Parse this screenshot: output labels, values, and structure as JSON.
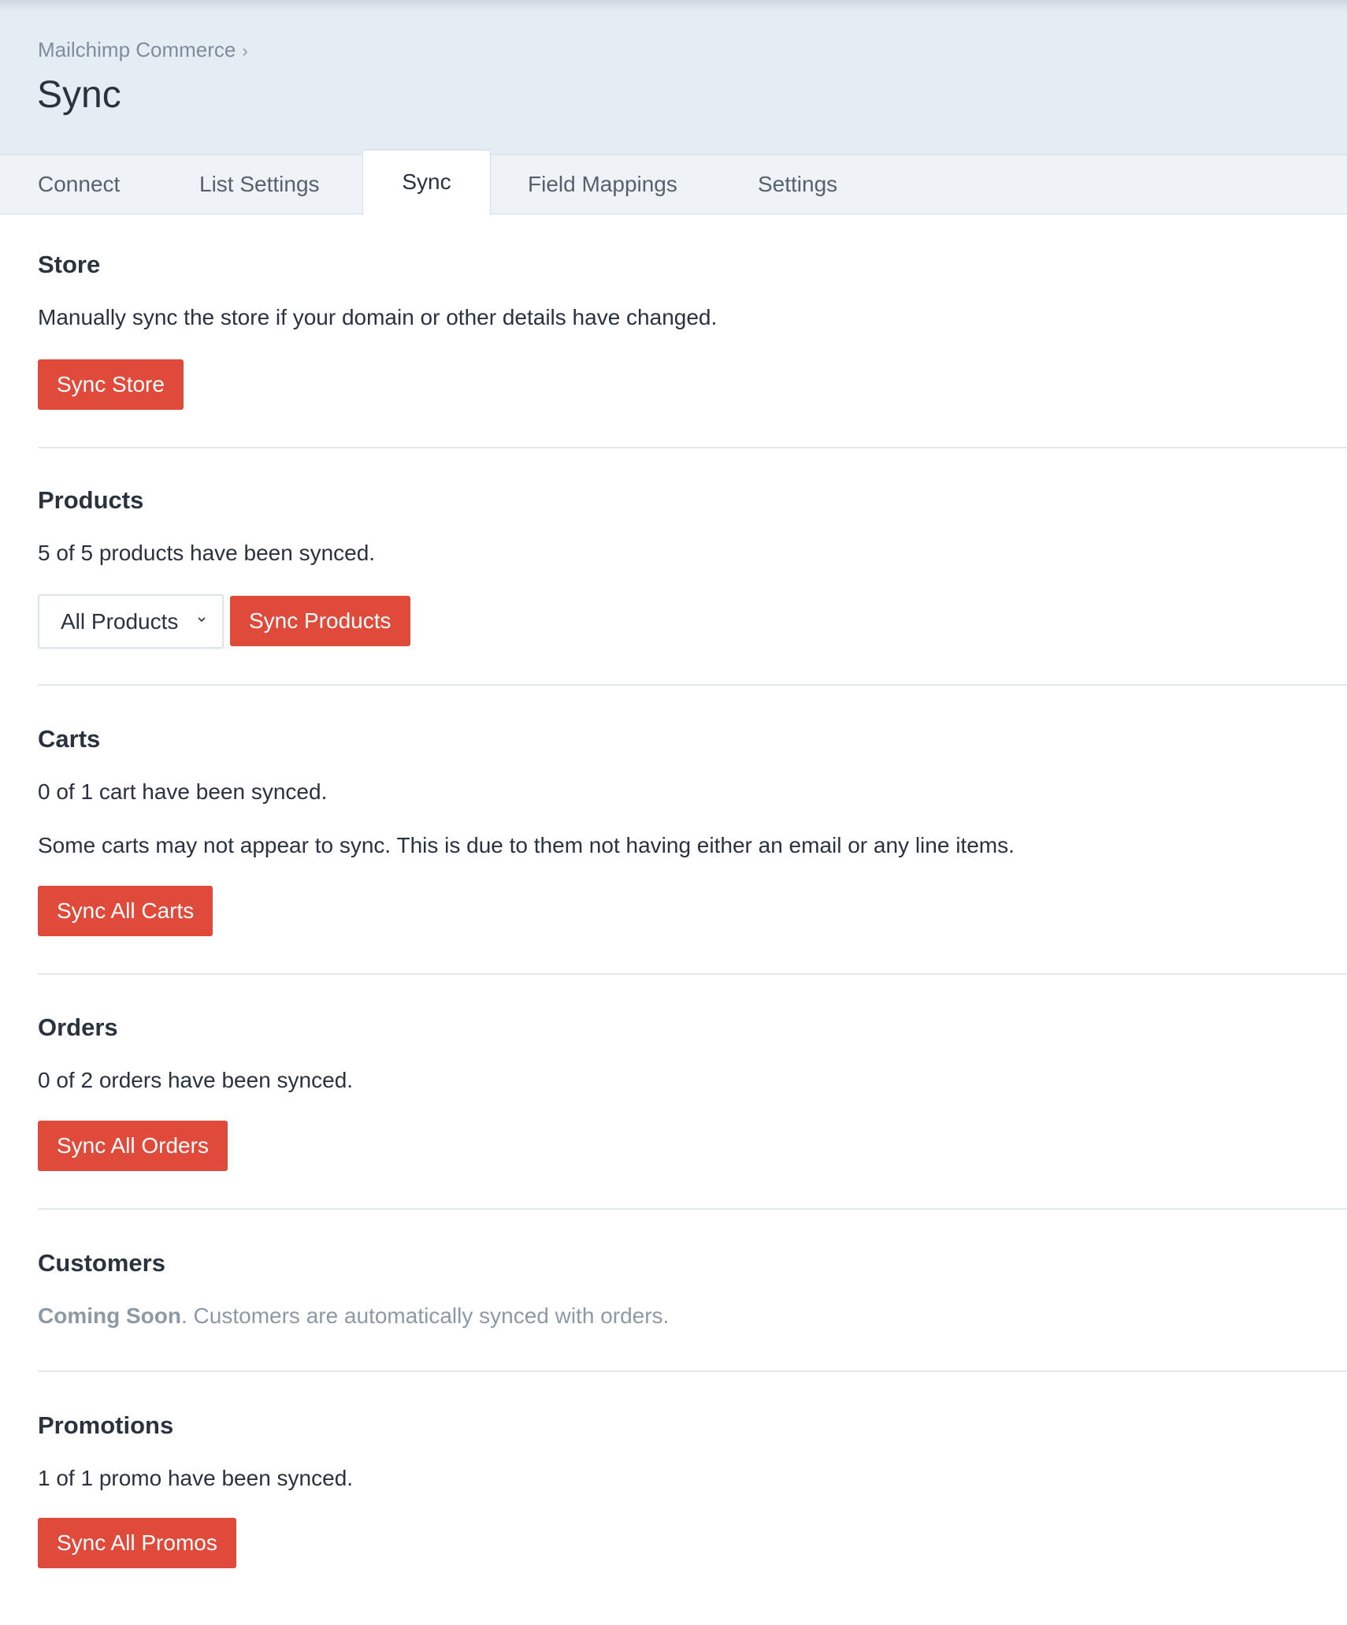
{
  "header": {
    "breadcrumb": "Mailchimp Commerce",
    "breadcrumb_separator": "›",
    "title": "Sync"
  },
  "tabs": [
    {
      "label": "Connect",
      "active": false
    },
    {
      "label": "List Settings",
      "active": false
    },
    {
      "label": "Sync",
      "active": true
    },
    {
      "label": "Field Mappings",
      "active": false
    },
    {
      "label": "Settings",
      "active": false
    }
  ],
  "sections": {
    "store": {
      "title": "Store",
      "description": "Manually sync the store if your domain or other details have changed.",
      "button": "Sync Store"
    },
    "products": {
      "title": "Products",
      "status": "5 of 5 products have been synced.",
      "filter_selected": "All Products",
      "button": "Sync Products"
    },
    "carts": {
      "title": "Carts",
      "status": "0 of 1 cart have been synced.",
      "note": "Some carts may not appear to sync. This is due to them not having either an email or any line items.",
      "button": "Sync All Carts"
    },
    "orders": {
      "title": "Orders",
      "status": "0 of 2 orders have been synced.",
      "button": "Sync All Orders"
    },
    "customers": {
      "title": "Customers",
      "coming_soon": "Coming Soon",
      "note": ". Customers are automatically synced with orders."
    },
    "promotions": {
      "title": "Promotions",
      "status": "1 of 1 promo have been synced.",
      "button": "Sync All Promos"
    }
  },
  "colors": {
    "accent": "#e04a3b",
    "header_bg": "#e4ecf4",
    "tab_bar_bg": "#eff3f7",
    "text": "#29323d",
    "muted": "#8e99a6"
  }
}
